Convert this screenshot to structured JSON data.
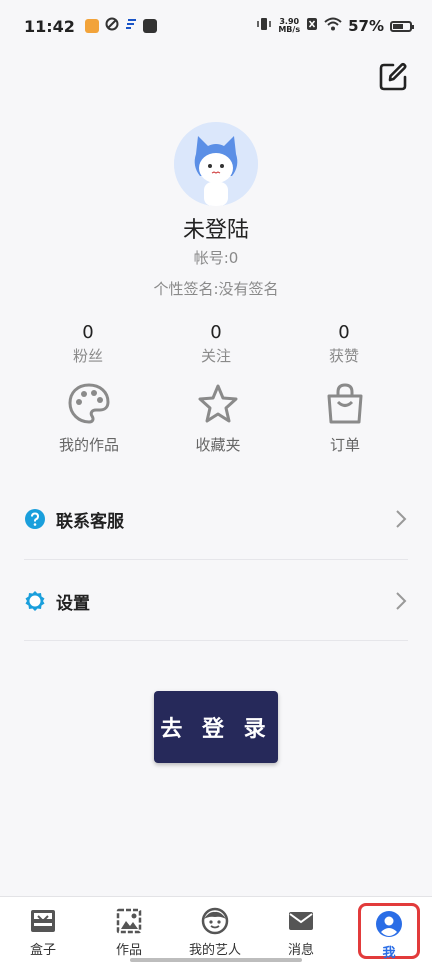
{
  "status_bar": {
    "time": "11:42",
    "net_speed_value": "3.90",
    "net_speed_unit": "MB/s",
    "battery": "57%"
  },
  "profile": {
    "username": "未登陆",
    "account": "帐号:0",
    "signature": "个性签名:没有签名"
  },
  "stats": [
    {
      "value": "0",
      "label": "粉丝"
    },
    {
      "value": "0",
      "label": "关注"
    },
    {
      "value": "0",
      "label": "获赞"
    }
  ],
  "actions": [
    {
      "label": "我的作品",
      "icon": "palette-icon"
    },
    {
      "label": "收藏夹",
      "icon": "star-icon"
    },
    {
      "label": "订单",
      "icon": "shopping-bag-icon"
    }
  ],
  "menu": [
    {
      "label": "联系客服",
      "icon": "help-icon"
    },
    {
      "label": "设置",
      "icon": "settings-icon"
    }
  ],
  "login_button": "去 登 录",
  "tabs": [
    {
      "label": "盒子",
      "icon": "box-icon"
    },
    {
      "label": "作品",
      "icon": "image-icon"
    },
    {
      "label": "我的艺人",
      "icon": "face-icon"
    },
    {
      "label": "消息",
      "icon": "mail-icon"
    },
    {
      "label": "我",
      "icon": "profile-icon",
      "active": true
    }
  ],
  "colors": {
    "accent": "#2a6de6",
    "menu_icon": "#1a9fdc",
    "login_bg": "#26295a",
    "highlight_border": "#e23b3b"
  }
}
